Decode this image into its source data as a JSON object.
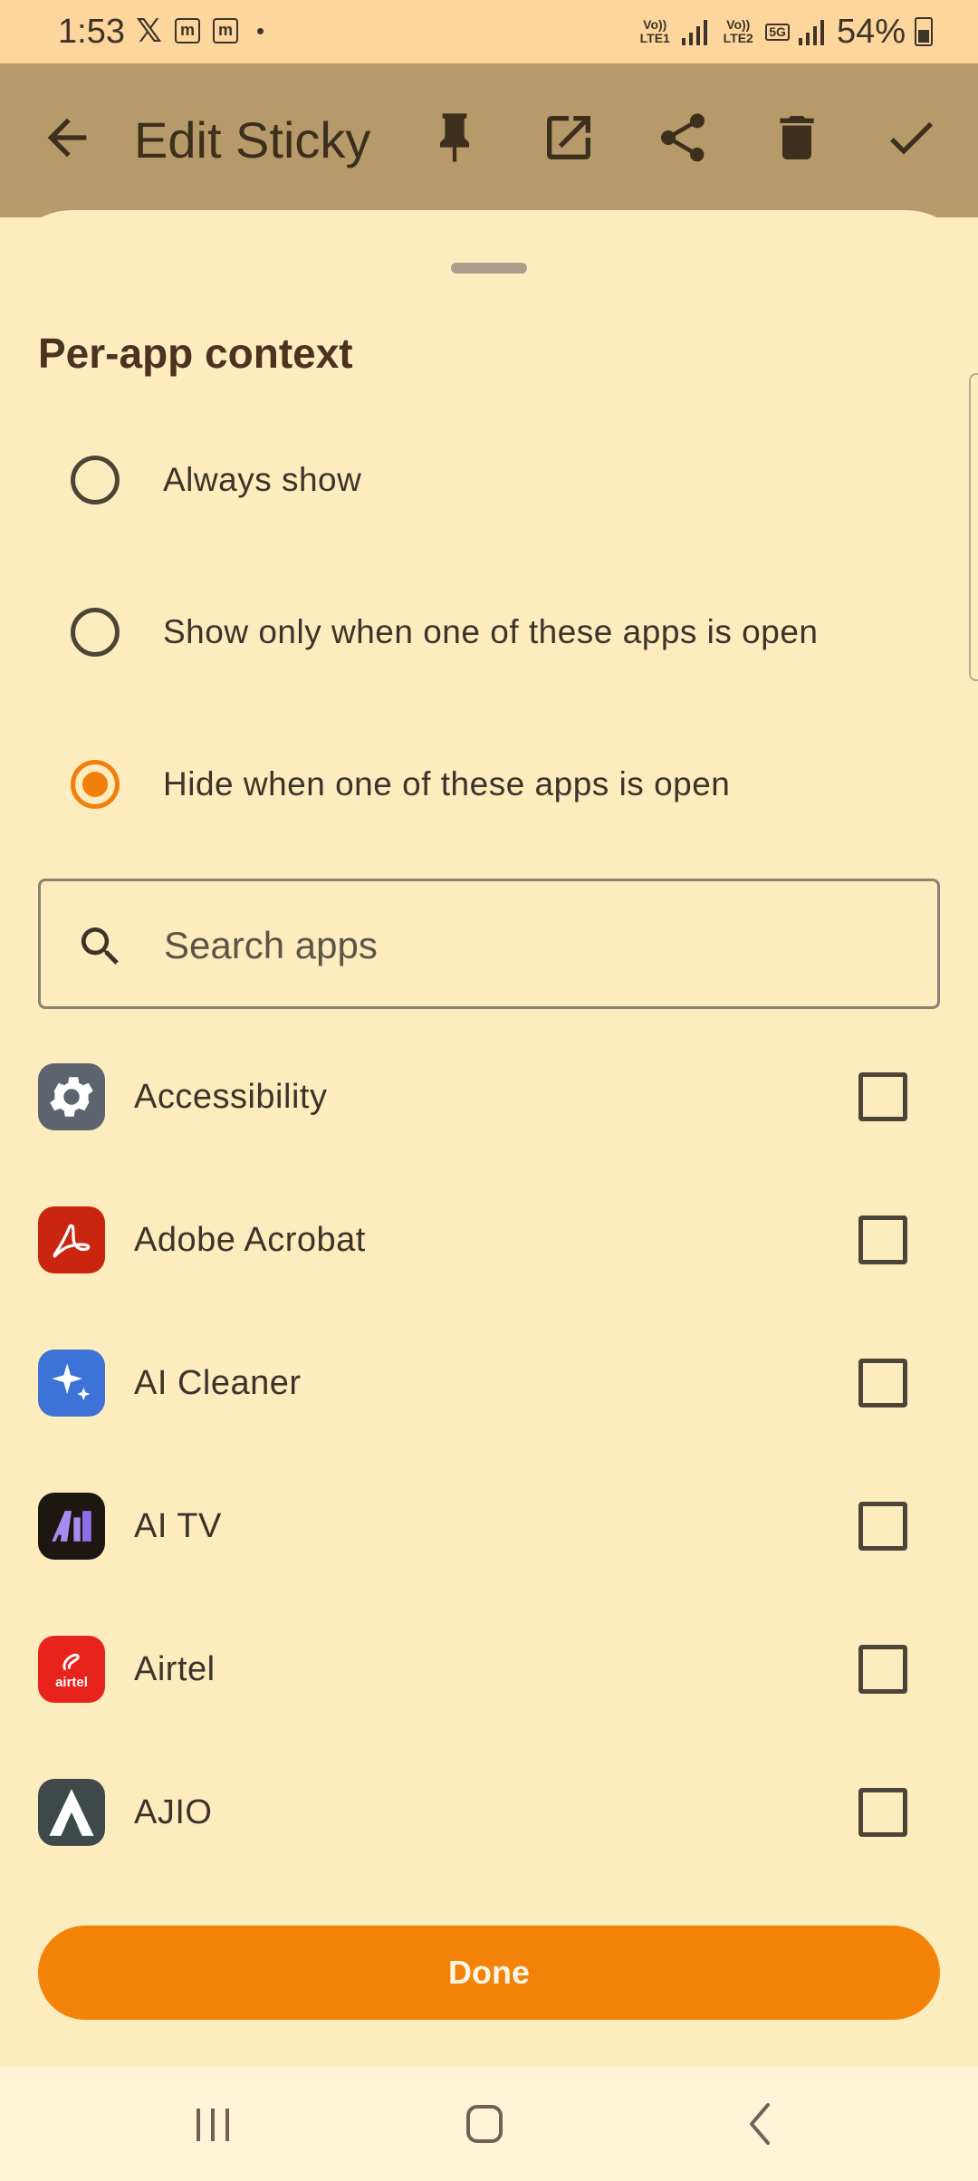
{
  "status_bar": {
    "time": "1:53",
    "x_glyph": "𝕏",
    "m_badge": "m",
    "dot": "•",
    "net1": "Vo)) LTE1",
    "net2": "Vo)) LTE2",
    "net_5g": "5G",
    "battery": "54%"
  },
  "app_bar": {
    "title": "Edit Sticky",
    "icons": [
      "back-arrow-icon",
      "pin-icon",
      "open-external-icon",
      "share-icon",
      "delete-icon",
      "check-icon"
    ]
  },
  "sheet": {
    "title": "Per-app context",
    "options": [
      {
        "label": "Always show",
        "selected": false
      },
      {
        "label": "Show only when one of these apps is open",
        "selected": false
      },
      {
        "label": "Hide when one of these apps is open",
        "selected": true
      }
    ],
    "search": {
      "placeholder": "Search apps",
      "value": ""
    },
    "apps": [
      {
        "name": "Accessibility",
        "icon": "gear-icon",
        "checked": false
      },
      {
        "name": "Adobe Acrobat",
        "icon": "acrobat-icon",
        "checked": false
      },
      {
        "name": "AI Cleaner",
        "icon": "sparkle-icon",
        "checked": false
      },
      {
        "name": "AI TV",
        "icon": "ai-tv-icon",
        "checked": false
      },
      {
        "name": "Airtel",
        "icon": "airtel-icon",
        "icon_text": "airtel",
        "checked": false
      },
      {
        "name": "AJIO",
        "icon": "ajio-icon",
        "checked": false
      }
    ],
    "done_label": "Done"
  },
  "colors": {
    "accent": "#f38208",
    "app_bar": "#b79a69",
    "status_bar": "#fdd69d",
    "sheet_bg": "#fdecbe"
  }
}
